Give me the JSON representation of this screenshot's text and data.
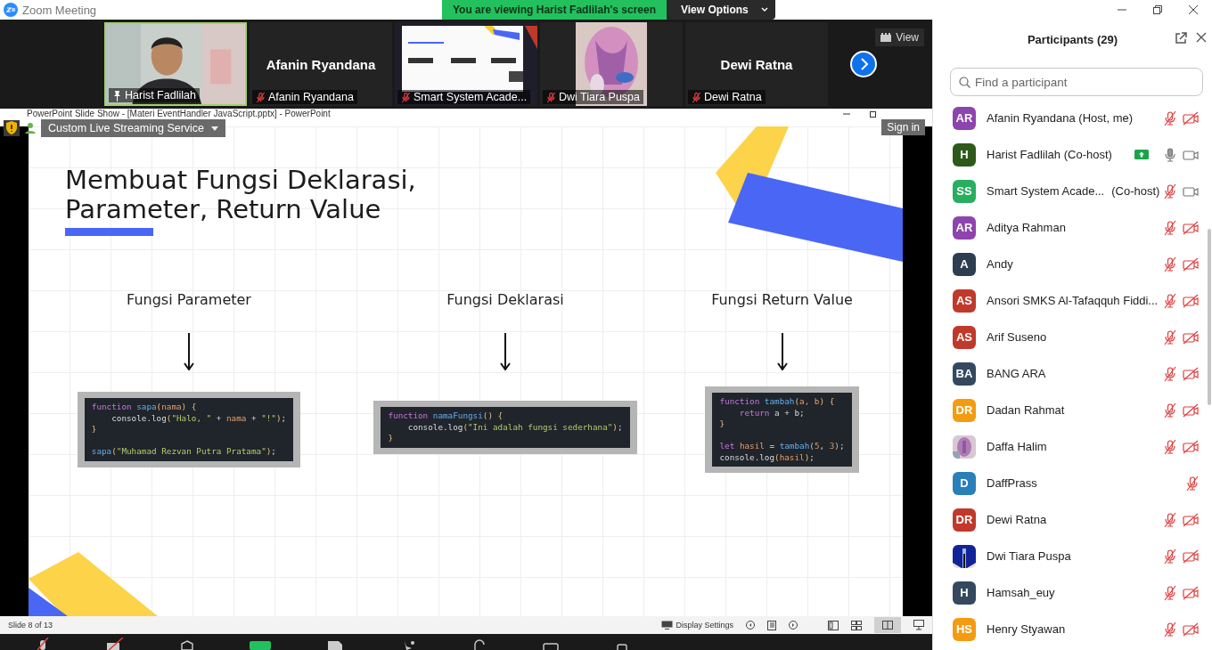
{
  "window": {
    "title": "Zoom Meeting"
  },
  "share_banner": {
    "text": "You are viewing Harist Fadlilah's screen",
    "button": "View Options"
  },
  "video_strip": {
    "view_button": "View",
    "tiles": [
      {
        "kind": "video",
        "label": "Harist Fadlilah",
        "pinned": true
      },
      {
        "kind": "name",
        "name": "Afanin Ryandana",
        "label": "Afanin Ryandana",
        "pinned": false,
        "muted": true
      },
      {
        "kind": "screen",
        "label": "Smart System Acade...",
        "pinned": false,
        "muted": true
      },
      {
        "kind": "video",
        "label": "Dwi Tiara Puspa",
        "pinned": false,
        "muted": true
      },
      {
        "kind": "name",
        "name": "Dewi Ratna",
        "label": "Dewi Ratna",
        "pinned": false,
        "muted": true
      }
    ]
  },
  "presentation": {
    "title": "PowerPoint Slide Show - [Materi EventHandler JavaScript.pptx] - PowerPoint",
    "overlay_menu": "Custom Live Streaming Service",
    "sign_in": "Sign in",
    "slide": {
      "title_lines": [
        "Membuat Fungsi Deklarasi,",
        "Parameter, Return Value"
      ],
      "columns": [
        {
          "heading": "Fungsi Parameter",
          "lines": [
            {
              "tokens": [
                {
                  "text": "function ",
                  "kind": "kw"
                },
                {
                  "text": "sapa",
                  "kind": "fn"
                },
                {
                  "text": "(",
                  "kind": "punc"
                },
                {
                  "text": "nama",
                  "kind": "param"
                },
                {
                  "text": ") {",
                  "kind": "punc"
                }
              ]
            },
            {
              "tokens": [
                {
                  "text": "    console.log",
                  "kind": "plain"
                },
                {
                  "text": "(",
                  "kind": "punc"
                },
                {
                  "text": "\"Halo, \"",
                  "kind": "str"
                },
                {
                  "text": " + ",
                  "kind": "plain"
                },
                {
                  "text": "nama",
                  "kind": "param"
                },
                {
                  "text": " + ",
                  "kind": "plain"
                },
                {
                  "text": "\"!\"",
                  "kind": "str"
                },
                {
                  "text": ")",
                  "kind": "punc"
                },
                {
                  "text": ";",
                  "kind": "plain"
                }
              ]
            },
            {
              "tokens": [
                {
                  "text": "}",
                  "kind": "punc"
                }
              ]
            },
            {
              "blank": true
            },
            {
              "tokens": [
                {
                  "text": "sapa",
                  "kind": "fn"
                },
                {
                  "text": "(",
                  "kind": "punc"
                },
                {
                  "text": "\"Muhamad Rezvan Putra Pratama\"",
                  "kind": "str"
                },
                {
                  "text": ")",
                  "kind": "punc"
                },
                {
                  "text": ";",
                  "kind": "plain"
                }
              ]
            }
          ]
        },
        {
          "heading": "Fungsi Deklarasi",
          "lines": [
            {
              "tokens": [
                {
                  "text": "function ",
                  "kind": "kw"
                },
                {
                  "text": "namaFungsi",
                  "kind": "fn"
                },
                {
                  "text": "() {",
                  "kind": "punc"
                }
              ]
            },
            {
              "tokens": [
                {
                  "text": "    console.log",
                  "kind": "plain"
                },
                {
                  "text": "(",
                  "kind": "punc"
                },
                {
                  "text": "\"Ini adalah fungsi sederhana\"",
                  "kind": "str"
                },
                {
                  "text": ")",
                  "kind": "punc"
                },
                {
                  "text": ";",
                  "kind": "plain"
                }
              ]
            },
            {
              "tokens": [
                {
                  "text": "}",
                  "kind": "punc"
                }
              ]
            }
          ]
        },
        {
          "heading": "Fungsi Return Value",
          "lines": [
            {
              "tokens": [
                {
                  "text": "function ",
                  "kind": "kw"
                },
                {
                  "text": "tambah",
                  "kind": "fn"
                },
                {
                  "text": "(",
                  "kind": "punc"
                },
                {
                  "text": "a, b",
                  "kind": "param"
                },
                {
                  "text": ") {",
                  "kind": "punc"
                }
              ]
            },
            {
              "tokens": [
                {
                  "text": "    return",
                  "kind": "kw"
                },
                {
                  "text": " a + b;",
                  "kind": "plain"
                }
              ]
            },
            {
              "tokens": [
                {
                  "text": "}",
                  "kind": "punc"
                }
              ]
            },
            {
              "blank": true
            },
            {
              "tokens": [
                {
                  "text": "let ",
                  "kind": "kw"
                },
                {
                  "text": "hasil",
                  "kind": "param"
                },
                {
                  "text": " = ",
                  "kind": "plain"
                },
                {
                  "text": "tambah",
                  "kind": "fn"
                },
                {
                  "text": "(",
                  "kind": "punc"
                },
                {
                  "text": "5",
                  "kind": "num"
                },
                {
                  "text": ", ",
                  "kind": "plain"
                },
                {
                  "text": "3",
                  "kind": "num"
                },
                {
                  "text": ")",
                  "kind": "punc"
                },
                {
                  "text": ";",
                  "kind": "plain"
                }
              ]
            },
            {
              "tokens": [
                {
                  "text": "console.log",
                  "kind": "plain"
                },
                {
                  "text": "(",
                  "kind": "punc"
                },
                {
                  "text": "hasil",
                  "kind": "param"
                },
                {
                  "text": ")",
                  "kind": "punc"
                },
                {
                  "text": ";",
                  "kind": "plain"
                }
              ]
            }
          ]
        }
      ]
    },
    "status": {
      "slide_counter": "Slide 8 of 13",
      "display_settings": "Display Settings"
    }
  },
  "participants": {
    "title": "Participants (29)",
    "search_placeholder": "Find a participant",
    "items": [
      {
        "kind": "initials",
        "initials": "AR",
        "color": "#8e44ad",
        "name": "Afanin Ryandana (Host, me)",
        "sharing": false,
        "mic_muted": true,
        "video_off": true
      },
      {
        "kind": "initials",
        "initials": "H",
        "color": "#2d5a1b",
        "name": "Harist Fadlilah (Co-host)",
        "sharing": true,
        "mic_muted": false,
        "video_off": false
      },
      {
        "kind": "initials",
        "initials": "SS",
        "color": "#27ae60",
        "name": "Smart System Acade...",
        "role": "(Co-host)",
        "sharing": false,
        "mic_muted": true,
        "video_off": false
      },
      {
        "kind": "initials",
        "initials": "AR",
        "color": "#8e44ad",
        "name": "Aditya Rahman",
        "sharing": false,
        "mic_muted": true,
        "video_off": true
      },
      {
        "kind": "initials",
        "initials": "A",
        "color": "#2c3e50",
        "name": "Andy",
        "sharing": false,
        "mic_muted": true,
        "video_off": true
      },
      {
        "kind": "initials",
        "initials": "AS",
        "color": "#c0392b",
        "name": "Ansori SMKS Al-Tafaqquh Fiddi...",
        "sharing": false,
        "mic_muted": true,
        "video_off": true
      },
      {
        "kind": "initials",
        "initials": "AS",
        "color": "#c0392b",
        "name": "Arif Suseno",
        "sharing": false,
        "mic_muted": true,
        "video_off": true
      },
      {
        "kind": "initials",
        "initials": "BA",
        "color": "#34495e",
        "name": "BANG ARA",
        "sharing": false,
        "mic_muted": true,
        "video_off": true
      },
      {
        "kind": "initials",
        "initials": "DR",
        "color": "#f39c12",
        "name": "Dadan Rahmat",
        "sharing": false,
        "mic_muted": true,
        "video_off": true
      },
      {
        "kind": "picture",
        "name": "Daffa Halim",
        "sharing": false,
        "mic_muted": true,
        "video_off": true
      },
      {
        "kind": "initials",
        "initials": "D",
        "color": "#2980b9",
        "name": "DaffPrass",
        "sharing": false,
        "mic_muted": true
      },
      {
        "kind": "initials",
        "initials": "DR",
        "color": "#c0392b",
        "name": "Dewi Ratna",
        "sharing": false,
        "mic_muted": true,
        "video_off": true
      },
      {
        "kind": "picture",
        "name": "Dwi Tiara Puspa",
        "sharing": false,
        "mic_muted": true,
        "video_off": true
      },
      {
        "kind": "initials",
        "initials": "H",
        "color": "#34495e",
        "name": "Hamsah_euy",
        "sharing": false,
        "mic_muted": true,
        "video_off": true
      },
      {
        "kind": "initials",
        "initials": "HS",
        "color": "#f39c12",
        "name": "Henry Styawan",
        "sharing": false,
        "mic_muted": true,
        "video_off": true
      }
    ]
  }
}
